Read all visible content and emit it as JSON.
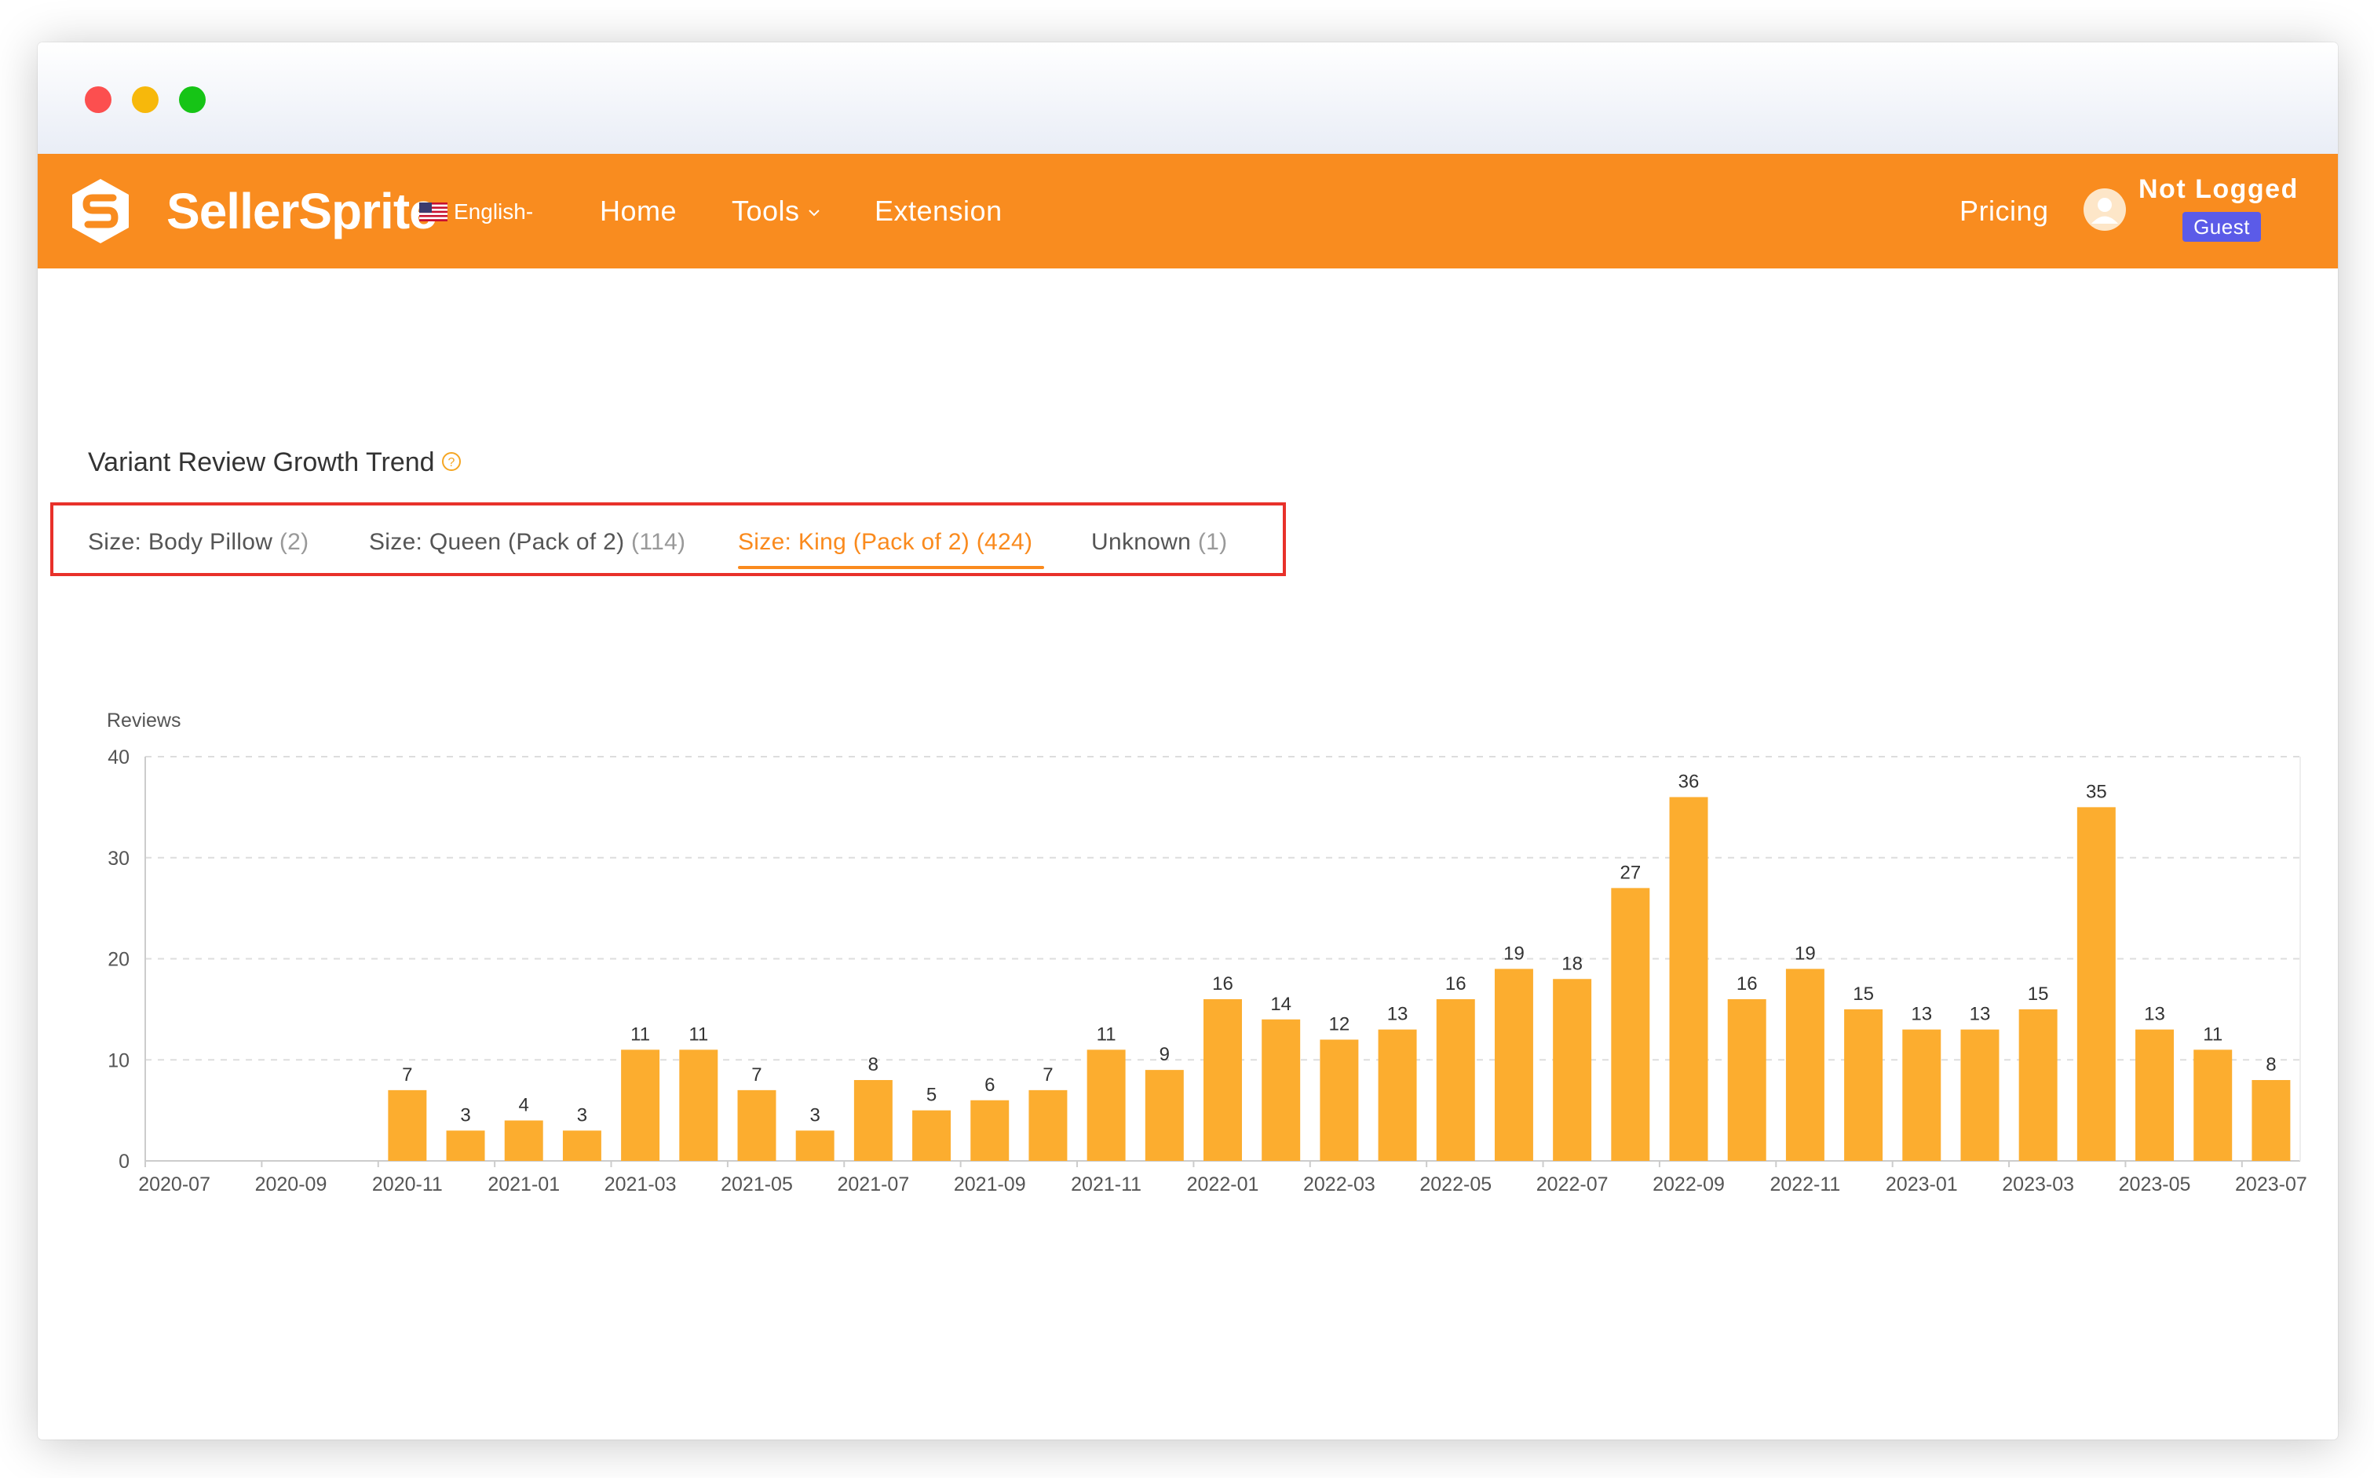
{
  "window": {
    "traffic_lights": [
      "close",
      "minimize",
      "maximize"
    ]
  },
  "navbar": {
    "logo_text": "SellerSprite",
    "language": "English-",
    "links": {
      "home": "Home",
      "tools": "Tools",
      "extension": "Extension",
      "pricing": "Pricing"
    },
    "user": {
      "name": "Not Logged",
      "badge": "Guest"
    },
    "colors": {
      "background": "#f98c1f",
      "badge": "#5b5be8"
    }
  },
  "section": {
    "title": "Variant Review Growth Trend",
    "help_icon": "question-circle-icon"
  },
  "tabs": [
    {
      "label": "Size: Body Pillow",
      "count": "(2)",
      "active": false
    },
    {
      "label": "Size: Queen (Pack of 2)",
      "count": "(114)",
      "active": false
    },
    {
      "label": "Size: King (Pack of 2)",
      "count": "(424)",
      "active": true
    },
    {
      "label": "Unknown",
      "count": "(1)",
      "active": false
    }
  ],
  "chart_data": {
    "type": "bar",
    "ylabel": "Reviews",
    "xlabel": "",
    "ylim": [
      0,
      40
    ],
    "yticks": [
      0,
      10,
      20,
      30,
      40
    ],
    "grid": true,
    "bar_color": "#fcad2f",
    "categories": [
      "2020-07",
      "2020-08",
      "2020-09",
      "2020-10",
      "2020-11",
      "2020-12",
      "2021-01",
      "2021-02",
      "2021-03",
      "2021-04",
      "2021-05",
      "2021-06",
      "2021-07",
      "2021-08",
      "2021-09",
      "2021-10",
      "2021-11",
      "2021-12",
      "2022-01",
      "2022-02",
      "2022-03",
      "2022-04",
      "2022-05",
      "2022-06",
      "2022-07",
      "2022-08",
      "2022-09",
      "2022-10",
      "2022-11",
      "2022-12",
      "2023-01",
      "2023-02",
      "2023-03",
      "2023-04",
      "2023-05",
      "2023-06",
      "2023-07"
    ],
    "values": [
      0,
      0,
      0,
      0,
      7,
      3,
      4,
      3,
      11,
      11,
      7,
      3,
      8,
      5,
      6,
      7,
      11,
      9,
      16,
      14,
      12,
      13,
      16,
      19,
      18,
      27,
      36,
      16,
      19,
      15,
      13,
      13,
      15,
      35,
      13,
      11,
      8
    ],
    "x_tick_labels": [
      "2020-07",
      "2020-09",
      "2020-11",
      "2021-01",
      "2021-03",
      "2021-05",
      "2021-07",
      "2021-09",
      "2021-11",
      "2022-01",
      "2022-03",
      "2022-05",
      "2022-07",
      "2022-09",
      "2022-11",
      "2023-01",
      "2023-03",
      "2023-05",
      "2023-07"
    ]
  }
}
